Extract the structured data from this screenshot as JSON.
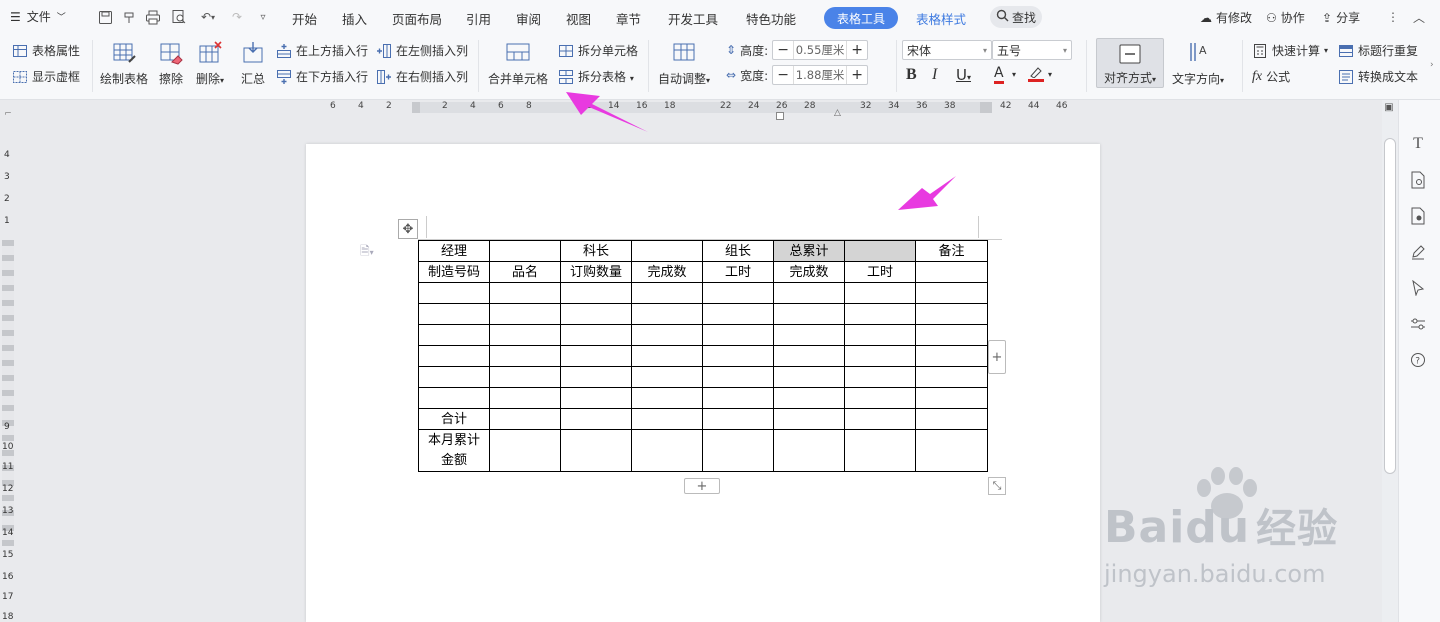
{
  "topbar": {
    "file_label": "文件",
    "tabs": [
      "开始",
      "插入",
      "页面布局",
      "引用",
      "审阅",
      "视图",
      "章节",
      "开发工具",
      "特色功能"
    ],
    "active_tab": "表格工具",
    "style_tab": "表格样式",
    "search_label": "查找",
    "right": {
      "changes": "有修改",
      "collab": "协作",
      "share": "分享"
    }
  },
  "ribbon": {
    "table_props": "表格属性",
    "show_gridlines": "显示虚框",
    "draw_table": "绘制表格",
    "erase": "擦除",
    "delete": "删除",
    "summary": "汇总",
    "insert_above": "在上方插入行",
    "insert_below": "在下方插入行",
    "insert_left": "在左侧插入列",
    "insert_right": "在右侧插入列",
    "merge_cells": "合并单元格",
    "split_cells": "拆分单元格",
    "split_table": "拆分表格",
    "auto_fit": "自动调整",
    "height_label": "高度:",
    "height_value": "0.55厘米",
    "width_label": "宽度:",
    "width_value": "1.88厘米",
    "font_name": "宋体",
    "font_size": "五号",
    "align": "对齐方式",
    "text_dir": "文字方向",
    "quick_calc": "快速计算",
    "repeat_header": "标题行重复",
    "formula": "公式",
    "to_text": "转换成文本"
  },
  "ruler": {
    "h_numbers": [
      "6",
      "4",
      "2",
      "2",
      "4",
      "6",
      "8",
      "12",
      "14",
      "16",
      "18",
      "22",
      "24",
      "26",
      "28",
      "32",
      "34",
      "36",
      "38",
      "42",
      "44",
      "46"
    ],
    "v_numbers": [
      "4",
      "3",
      "2",
      "1",
      "9",
      "10",
      "11",
      "12",
      "13",
      "14",
      "15",
      "16",
      "17",
      "18"
    ]
  },
  "table": {
    "row1": [
      "经理",
      "",
      "科长",
      "",
      "组长",
      "总累计",
      "",
      "备注"
    ],
    "row2": [
      "制造号码",
      "品名",
      "订购数量",
      "完成数",
      "工时",
      "完成数",
      "工时",
      ""
    ],
    "empty_rows": 6,
    "total_label": "合计",
    "monthly_label_1": "本月累计",
    "monthly_label_2": "金额"
  },
  "colors": {
    "accent": "#4a83e8",
    "arrow": "#e83ae0",
    "selected_cell": "#d4d4d4"
  },
  "watermark": {
    "brand": "Baidu",
    "cn": "经验",
    "url": "jingyan.baidu.com"
  }
}
